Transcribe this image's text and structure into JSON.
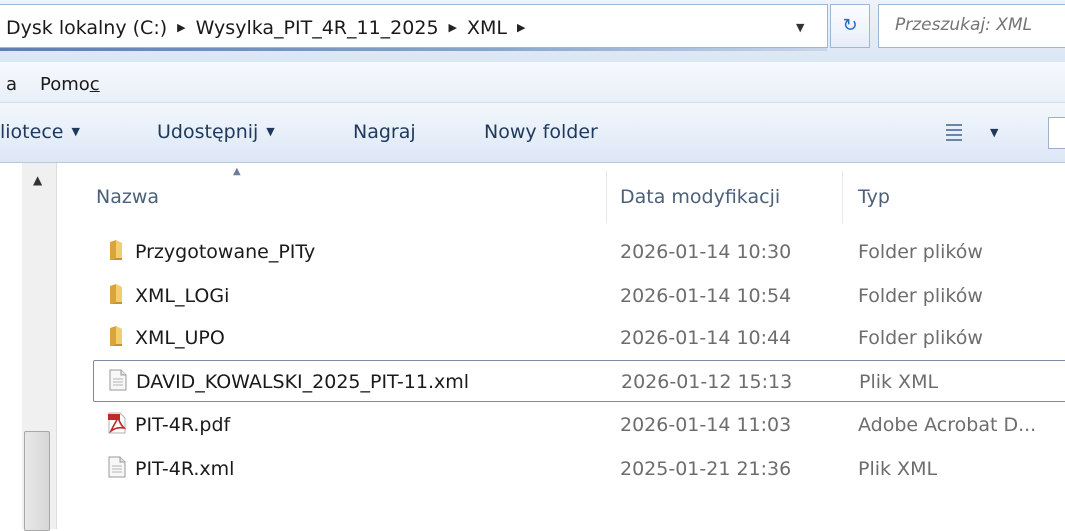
{
  "address": {
    "crumbs": [
      "Dysk lokalny (C:)",
      "Wysylka_PIT_4R_11_2025",
      "XML"
    ],
    "separator": "▶",
    "dropdown_glyph": "▼",
    "refresh_glyph": "↻",
    "search_placeholder": "Przeszukaj: XML"
  },
  "menu": {
    "partial_item": "a",
    "help_prefix": "Pomo",
    "help_mnemonic": "c"
  },
  "toolbar": {
    "library": "liotece",
    "share": "Udostępnij",
    "burn": "Nagraj",
    "new_folder": "Nowy folder",
    "caret": "▼"
  },
  "columns": {
    "name": "Nazwa",
    "date": "Data modyfikacji",
    "type": "Typ",
    "sort_glyph": "▲"
  },
  "files": [
    {
      "name": "Przygotowane_PITy",
      "date": "2026-01-14 10:30",
      "type": "Folder plików",
      "icon": "folder-icon"
    },
    {
      "name": "XML_LOGi",
      "date": "2026-01-14 10:54",
      "type": "Folder plików",
      "icon": "folder-icon"
    },
    {
      "name": "XML_UPO",
      "date": "2026-01-14 10:44",
      "type": "Folder plików",
      "icon": "folder-icon"
    },
    {
      "name": "DAVID_KOWALSKI_2025_PIT-11.xml",
      "date": "2026-01-12 15:13",
      "type": "Plik XML",
      "icon": "xml-file-icon",
      "selected": true
    },
    {
      "name": "PIT-4R.pdf",
      "date": "2026-01-14 11:03",
      "type": "Adobe Acrobat D...",
      "icon": "pdf-file-icon"
    },
    {
      "name": "PIT-4R.xml",
      "date": "2025-01-21 21:36",
      "type": "Plik XML",
      "icon": "xml-file-icon"
    }
  ],
  "colors": {
    "folder": "#e8b84a",
    "pdf": "#c0282d",
    "selection_border": "#7a8da4",
    "toolbar_text": "#1e395b"
  }
}
